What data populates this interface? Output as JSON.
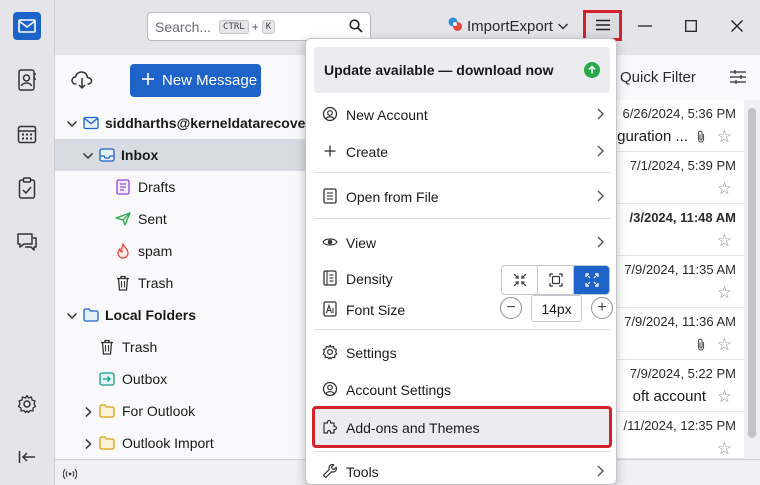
{
  "search": {
    "placeholder": "Search...",
    "shortcut_mod": "CTRL",
    "shortcut_plus": "+",
    "shortcut_key": "K"
  },
  "account_switch": {
    "label": "ImportExport"
  },
  "folder_pane": {
    "new_message_label": "New Message",
    "folders": [
      {
        "label": "siddharths@kerneldatarecove",
        "level": 0,
        "expanded": true,
        "bold": true,
        "icon": "account-mail-icon"
      },
      {
        "label": "Inbox",
        "level": 1,
        "expanded": true,
        "bold": true,
        "selected": true,
        "icon": "inbox-icon"
      },
      {
        "label": "Drafts",
        "level": 2,
        "icon": "drafts-icon"
      },
      {
        "label": "Sent",
        "level": 2,
        "icon": "sent-icon"
      },
      {
        "label": "spam",
        "level": 2,
        "icon": "spam-icon"
      },
      {
        "label": "Trash",
        "level": 2,
        "icon": "trash-icon"
      },
      {
        "label": "Local Folders",
        "level": 0,
        "expanded": true,
        "bold": true,
        "icon": "folder-icon"
      },
      {
        "label": "Trash",
        "level": 1,
        "icon": "trash-icon"
      },
      {
        "label": "Outbox",
        "level": 1,
        "icon": "outbox-icon"
      },
      {
        "label": "For Outlook",
        "level": 1,
        "collapsed": true,
        "icon": "folder-icon"
      },
      {
        "label": "Outlook Import",
        "level": 1,
        "collapsed": true,
        "icon": "folder-icon"
      }
    ]
  },
  "message_list": {
    "quick_filter_label": "Quick Filter",
    "rows": [
      {
        "date": "6/26/2024, 5:36 PM",
        "subject": "guration ...",
        "attachment": true
      },
      {
        "date": "7/1/2024, 5:39 PM",
        "subject": ""
      },
      {
        "date": "/3/2024, 11:48 AM",
        "subject": "",
        "bold": true
      },
      {
        "date": "7/9/2024, 11:35 AM",
        "subject": ""
      },
      {
        "date": "7/9/2024, 11:36 AM",
        "subject": "",
        "attachment": true
      },
      {
        "date": "7/9/2024, 5:22 PM",
        "subject": "oft account"
      },
      {
        "date": "/11/2024, 12:35 PM",
        "subject": ""
      }
    ]
  },
  "app_menu": {
    "update_text": "Update available — download now",
    "items": {
      "new_account": "New Account",
      "create": "Create",
      "open_from_file": "Open from File",
      "view": "View",
      "density": "Density",
      "font_size": "Font Size",
      "font_size_value": "14px",
      "settings": "Settings",
      "account_settings": "Account Settings",
      "addons_themes": "Add-ons and Themes",
      "tools": "Tools"
    }
  },
  "colors": {
    "accent": "#1e63c8",
    "highlight_border": "#d2232a",
    "update_badge": "#2ba84a"
  }
}
